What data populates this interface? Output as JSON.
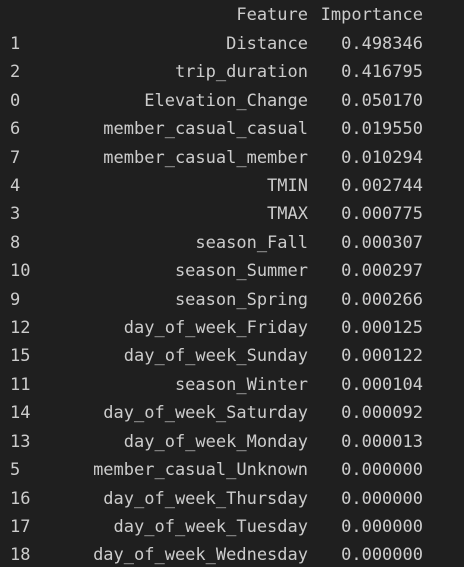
{
  "table": {
    "columns": [
      "Feature",
      "Importance"
    ],
    "rows": [
      {
        "index": "1",
        "feature": "Distance",
        "importance": "0.498346"
      },
      {
        "index": "2",
        "feature": "trip_duration",
        "importance": "0.416795"
      },
      {
        "index": "0",
        "feature": "Elevation_Change",
        "importance": "0.050170"
      },
      {
        "index": "6",
        "feature": "member_casual_casual",
        "importance": "0.019550"
      },
      {
        "index": "7",
        "feature": "member_casual_member",
        "importance": "0.010294"
      },
      {
        "index": "4",
        "feature": "TMIN",
        "importance": "0.002744"
      },
      {
        "index": "3",
        "feature": "TMAX",
        "importance": "0.000775"
      },
      {
        "index": "8",
        "feature": "season_Fall",
        "importance": "0.000307"
      },
      {
        "index": "10",
        "feature": "season_Summer",
        "importance": "0.000297"
      },
      {
        "index": "9",
        "feature": "season_Spring",
        "importance": "0.000266"
      },
      {
        "index": "12",
        "feature": "day_of_week_Friday",
        "importance": "0.000125"
      },
      {
        "index": "15",
        "feature": "day_of_week_Sunday",
        "importance": "0.000122"
      },
      {
        "index": "11",
        "feature": "season_Winter",
        "importance": "0.000104"
      },
      {
        "index": "14",
        "feature": "day_of_week_Saturday",
        "importance": "0.000092"
      },
      {
        "index": "13",
        "feature": "day_of_week_Monday",
        "importance": "0.000013"
      },
      {
        "index": "5",
        "feature": "member_casual_Unknown",
        "importance": "0.000000"
      },
      {
        "index": "16",
        "feature": "day_of_week_Thursday",
        "importance": "0.000000"
      },
      {
        "index": "17",
        "feature": "day_of_week_Tuesday",
        "importance": "0.000000"
      },
      {
        "index": "18",
        "feature": "day_of_week_Wednesday",
        "importance": "0.000000"
      }
    ]
  },
  "colors": {
    "background": "#1f1f1f",
    "text": "#cccccc"
  }
}
